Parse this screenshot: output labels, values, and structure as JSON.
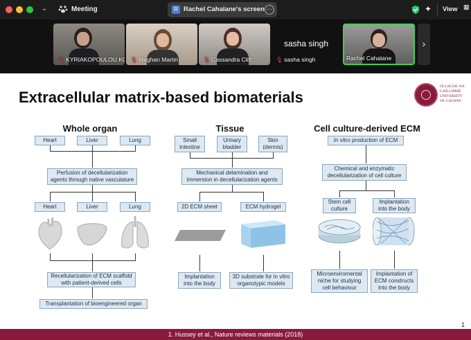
{
  "topbar": {
    "app_label": "Meeting",
    "share_label": "Rachel Cahalane's screen",
    "share_avatar_letter": "R",
    "view_label": "View",
    "colors": {
      "close": "#ff5f57",
      "min": "#febc2e",
      "max": "#28c840",
      "shield": "#2ecc71"
    }
  },
  "participants": [
    {
      "name": "KYRIAKOPOULOU KO...",
      "muted": true
    },
    {
      "name": "Meghan Martin",
      "muted": true
    },
    {
      "name": "Cassandra Clift",
      "muted": true
    },
    {
      "name": "sasha singh",
      "muted": true,
      "placeholder_name": "sasha singh"
    },
    {
      "name": "Rachel Cahalane",
      "muted": false,
      "active": true
    }
  ],
  "slide": {
    "title": "Extracellular matrix-based biomaterials",
    "logo_lines": [
      "OLLSCOIL NA",
      "GAILLIMHE",
      "UNIVERSITY",
      "OF GALWAY"
    ],
    "page_number": "1",
    "footer": "1. Hussey et al., Nature reviews materials (2018)",
    "columns": {
      "whole_organ": {
        "heading": "Whole organ",
        "top": [
          "Heart",
          "Liver",
          "Lung"
        ],
        "perfusion": "Perfusion of decellularization agents through native vasculature",
        "mid": [
          "Heart",
          "Liver",
          "Lung"
        ],
        "recell": "Recellularization of ECM scaffold with patient-derived cells",
        "transplant": "Transplantation of bioengineered organ"
      },
      "tissue": {
        "heading": "Tissue",
        "top": [
          "Small intestine",
          "Urinary bladder",
          "Skin (dermis)"
        ],
        "mech": "Mechanical delamination and immersion in decellularization agents",
        "mid": [
          "2D ECM sheet",
          "ECM hydrogel"
        ],
        "bottom": [
          "Implantation into the body",
          "3D substrate for in vitro organotypic models"
        ]
      },
      "culture": {
        "heading": "Cell culture-derived ECM",
        "top": "In vitro production of ECM",
        "chem": "Chemical and enzymatic decellularization of cell culture",
        "mid": [
          "Stem cell culture",
          "Implantation into the body"
        ],
        "bottom": [
          "Microenviromental niche for studying cell behaviour",
          "Implantation of ECM constructs into the body"
        ]
      }
    }
  }
}
